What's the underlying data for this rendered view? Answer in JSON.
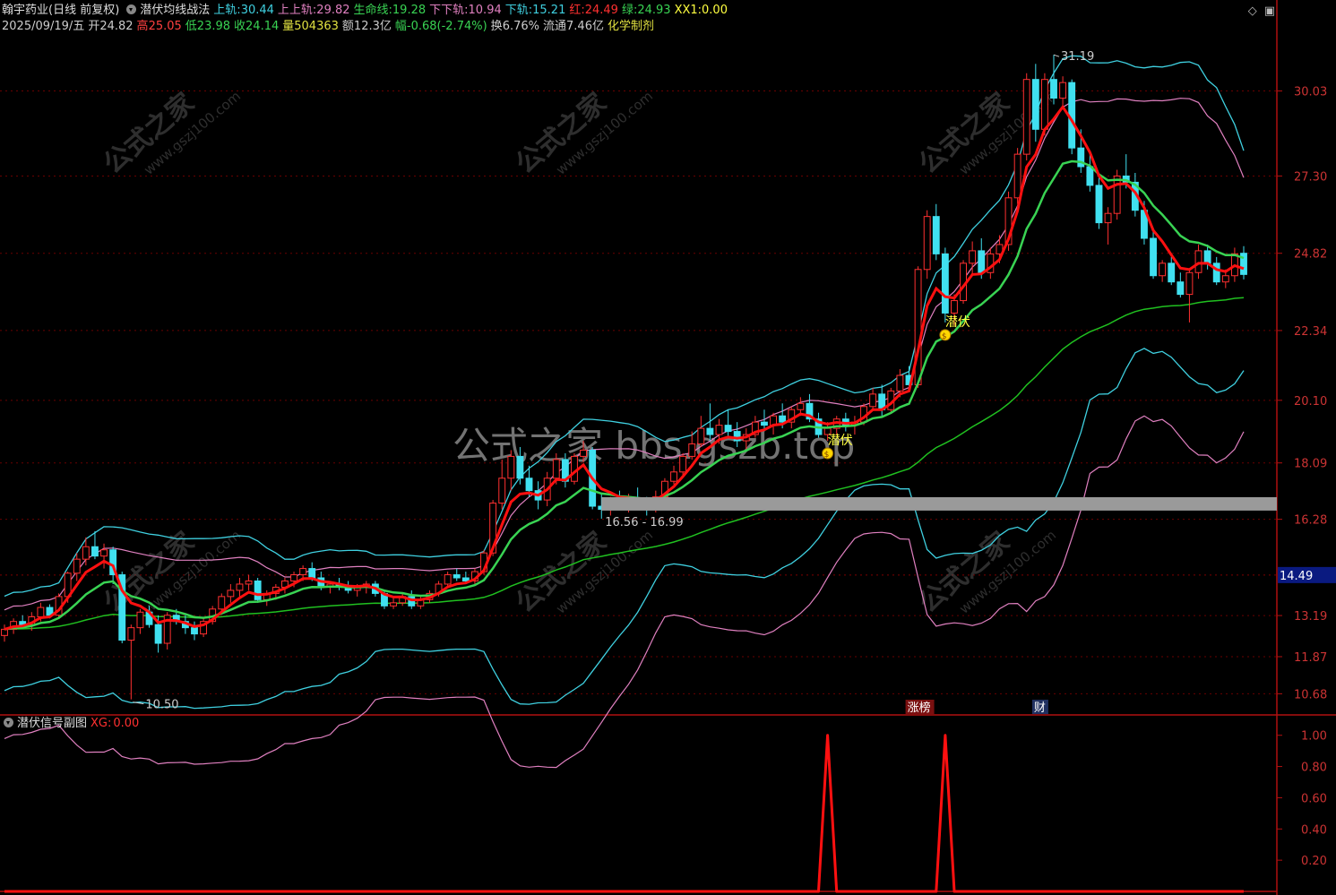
{
  "header": {
    "stock": "翰宇药业(日线 前复权)",
    "indicator": "潜伏均线战法",
    "values": [
      {
        "label": "上轨:",
        "value": "30.44",
        "color": "#3fd0e0"
      },
      {
        "label": "上上轨:",
        "value": "29.82",
        "color": "#e080c0"
      },
      {
        "label": "生命线:",
        "value": "19.28",
        "color": "#39d353"
      },
      {
        "label": "下下轨:",
        "value": "10.94",
        "color": "#e080c0"
      },
      {
        "label": "下轨:",
        "value": "15.21",
        "color": "#3fd0e0"
      },
      {
        "label": "红:",
        "value": "24.49",
        "color": "#ff3030"
      },
      {
        "label": "绿:",
        "value": "24.93",
        "color": "#39d353"
      },
      {
        "label": "XX1:",
        "value": "0.00",
        "color": "#ffff40"
      }
    ],
    "quote": [
      {
        "label": "2025/09/19/五",
        "value": "",
        "color": "#cccccc"
      },
      {
        "label": "开",
        "value": "24.82",
        "color": "#cccccc"
      },
      {
        "label": "高",
        "value": "25.05",
        "color": "#ff4040"
      },
      {
        "label": "低",
        "value": "23.98",
        "color": "#39d353"
      },
      {
        "label": "收",
        "value": "24.14",
        "color": "#39d353"
      },
      {
        "label": "量",
        "value": "504363",
        "color": "#e0e040"
      },
      {
        "label": "额",
        "value": "12.3亿",
        "color": "#cccccc"
      },
      {
        "label": "幅",
        "value": "-0.68(-2.74%)",
        "color": "#39d353"
      },
      {
        "label": "换",
        "value": "6.76%",
        "color": "#cccccc"
      },
      {
        "label": "流通",
        "value": "7.46亿",
        "color": "#cccccc"
      },
      {
        "label": "化学制剂",
        "value": "",
        "color": "#e0e040"
      }
    ],
    "corner_icons": [
      "diamond-icon",
      "maximize-icon"
    ]
  },
  "watermarks": {
    "center": "公式之家 bbs.gszb.top",
    "tile_cn": "公式之家",
    "tile_url": "www.gszj100.com"
  },
  "chart_data": [
    {
      "type": "candlestick",
      "yticks": [
        "30.03",
        "27.30",
        "24.82",
        "22.34",
        "20.10",
        "18.09",
        "16.28",
        "14.49",
        "13.19",
        "11.87",
        "10.68"
      ],
      "current_price": "14.49",
      "ylim": [
        10.0,
        31.8
      ],
      "colors": {
        "up": "#ff3030",
        "down": "#40e0f0",
        "ma_red": "#ff1010",
        "life_line": "#39d353",
        "upper_band": "#3fd0e0",
        "upper_upper_band": "#e080c0",
        "lower_band": "#3fd0e0",
        "lower_lower_band": "#e080c0",
        "long_ma": "#20c020"
      },
      "annotations": {
        "high": "31.19",
        "low": "10.50",
        "box_range": "16.56 - 16.99",
        "signal_label": "潜伏",
        "tags": [
          "涨榜",
          "财"
        ]
      },
      "ohlc": [
        [
          12.55,
          12.9,
          12.35,
          12.75
        ],
        [
          12.75,
          13.1,
          12.6,
          13.0
        ],
        [
          13.0,
          13.2,
          12.8,
          12.9
        ],
        [
          12.9,
          13.3,
          12.7,
          13.15
        ],
        [
          13.15,
          13.6,
          13.0,
          13.45
        ],
        [
          13.45,
          13.55,
          13.1,
          13.2
        ],
        [
          13.2,
          13.9,
          13.1,
          13.8
        ],
        [
          13.8,
          14.6,
          13.6,
          14.55
        ],
        [
          14.55,
          15.2,
          14.3,
          15.0
        ],
        [
          15.0,
          15.7,
          14.8,
          15.4
        ],
        [
          15.4,
          15.9,
          15.0,
          15.1
        ],
        [
          15.1,
          15.5,
          14.7,
          15.3
        ],
        [
          15.3,
          15.4,
          14.2,
          14.5
        ],
        [
          14.5,
          14.6,
          12.3,
          12.4
        ],
        [
          12.4,
          12.9,
          10.5,
          12.8
        ],
        [
          12.8,
          13.4,
          12.6,
          13.3
        ],
        [
          13.3,
          13.5,
          12.8,
          12.9
        ],
        [
          12.9,
          13.2,
          12.0,
          12.3
        ],
        [
          12.3,
          13.3,
          12.1,
          13.2
        ],
        [
          13.2,
          13.4,
          12.9,
          13.0
        ],
        [
          13.0,
          13.2,
          12.6,
          12.8
        ],
        [
          12.8,
          13.0,
          12.4,
          12.6
        ],
        [
          12.6,
          13.1,
          12.5,
          13.0
        ],
        [
          13.0,
          13.5,
          12.9,
          13.4
        ],
        [
          13.4,
          13.9,
          13.3,
          13.8
        ],
        [
          13.8,
          14.2,
          13.6,
          14.0
        ],
        [
          14.0,
          14.4,
          13.8,
          14.2
        ],
        [
          14.2,
          14.5,
          14.0,
          14.3
        ],
        [
          14.3,
          14.4,
          13.6,
          13.7
        ],
        [
          13.7,
          14.0,
          13.5,
          13.9
        ],
        [
          13.9,
          14.2,
          13.7,
          14.1
        ],
        [
          14.1,
          14.4,
          13.9,
          14.3
        ],
        [
          14.3,
          14.6,
          14.1,
          14.5
        ],
        [
          14.5,
          14.8,
          14.3,
          14.7
        ],
        [
          14.7,
          14.9,
          14.3,
          14.4
        ],
        [
          14.4,
          14.6,
          14.0,
          14.1
        ],
        [
          14.1,
          14.3,
          13.9,
          14.2
        ],
        [
          14.2,
          14.4,
          14.0,
          14.1
        ],
        [
          14.1,
          14.3,
          13.9,
          14.0
        ],
        [
          14.0,
          14.2,
          13.8,
          14.1
        ],
        [
          14.1,
          14.3,
          13.9,
          14.2
        ],
        [
          14.2,
          14.3,
          13.8,
          13.9
        ],
        [
          13.9,
          14.0,
          13.4,
          13.5
        ],
        [
          13.5,
          13.8,
          13.4,
          13.6
        ],
        [
          13.6,
          13.9,
          13.5,
          13.8
        ],
        [
          13.8,
          14.0,
          13.4,
          13.5
        ],
        [
          13.5,
          13.8,
          13.4,
          13.7
        ],
        [
          13.7,
          14.0,
          13.6,
          13.9
        ],
        [
          13.9,
          14.3,
          13.8,
          14.2
        ],
        [
          14.2,
          14.6,
          14.1,
          14.5
        ],
        [
          14.5,
          14.7,
          14.3,
          14.4
        ],
        [
          14.4,
          14.6,
          14.2,
          14.3
        ],
        [
          14.3,
          14.7,
          14.2,
          14.6
        ],
        [
          14.6,
          15.3,
          14.5,
          15.2
        ],
        [
          15.2,
          16.9,
          15.1,
          16.8
        ],
        [
          16.8,
          18.2,
          16.6,
          17.6
        ],
        [
          17.6,
          18.5,
          17.2,
          18.3
        ],
        [
          18.3,
          18.6,
          17.4,
          17.6
        ],
        [
          17.6,
          18.0,
          17.0,
          17.2
        ],
        [
          17.2,
          17.5,
          16.6,
          16.9
        ],
        [
          16.9,
          17.8,
          16.7,
          17.6
        ],
        [
          17.6,
          18.4,
          17.4,
          18.2
        ],
        [
          18.2,
          18.4,
          17.3,
          17.5
        ],
        [
          17.5,
          18.4,
          17.4,
          18.3
        ],
        [
          18.3,
          18.8,
          18.1,
          18.5
        ],
        [
          18.5,
          18.6,
          16.6,
          16.7
        ],
        [
          16.7,
          17.1,
          16.3,
          16.6
        ],
        [
          16.6,
          17.0,
          16.4,
          16.9
        ],
        [
          16.9,
          17.2,
          16.6,
          16.7
        ],
        [
          16.7,
          17.1,
          16.5,
          16.9
        ],
        [
          16.9,
          17.3,
          16.7,
          16.8
        ],
        [
          16.8,
          17.0,
          16.4,
          16.7
        ],
        [
          16.7,
          17.2,
          16.5,
          17.0
        ],
        [
          17.0,
          17.6,
          16.9,
          17.5
        ],
        [
          17.5,
          18.0,
          17.4,
          17.8
        ],
        [
          17.8,
          18.4,
          17.7,
          18.3
        ],
        [
          18.3,
          19.1,
          18.2,
          18.7
        ],
        [
          18.7,
          19.6,
          18.6,
          19.2
        ],
        [
          19.2,
          20.0,
          18.8,
          19.0
        ],
        [
          19.0,
          19.5,
          18.7,
          19.3
        ],
        [
          19.3,
          19.8,
          18.9,
          19.1
        ],
        [
          19.1,
          19.4,
          18.6,
          18.8
        ],
        [
          18.8,
          19.2,
          18.5,
          19.0
        ],
        [
          19.0,
          19.6,
          18.9,
          19.4
        ],
        [
          19.4,
          19.8,
          19.1,
          19.3
        ],
        [
          19.3,
          19.7,
          19.0,
          19.6
        ],
        [
          19.6,
          20.0,
          19.2,
          19.4
        ],
        [
          19.4,
          19.9,
          19.2,
          19.8
        ],
        [
          19.8,
          20.2,
          19.6,
          20.0
        ],
        [
          20.0,
          20.3,
          19.4,
          19.5
        ],
        [
          19.5,
          19.7,
          18.9,
          19.0
        ],
        [
          19.0,
          19.4,
          18.8,
          19.2
        ],
        [
          19.2,
          19.6,
          19.0,
          19.5
        ],
        [
          19.5,
          19.7,
          19.1,
          19.3
        ],
        [
          19.3,
          19.6,
          19.0,
          19.4
        ],
        [
          19.4,
          20.0,
          19.3,
          19.9
        ],
        [
          19.9,
          20.5,
          19.8,
          20.3
        ],
        [
          20.3,
          20.6,
          19.6,
          19.8
        ],
        [
          19.8,
          20.5,
          19.7,
          20.4
        ],
        [
          20.4,
          21.1,
          20.2,
          20.9
        ],
        [
          20.9,
          21.2,
          20.4,
          20.6
        ],
        [
          20.6,
          24.4,
          20.5,
          24.3
        ],
        [
          24.3,
          26.2,
          24.0,
          26.0
        ],
        [
          26.0,
          26.4,
          24.6,
          24.8
        ],
        [
          24.8,
          25.0,
          22.6,
          22.9
        ],
        [
          22.9,
          23.5,
          22.5,
          23.3
        ],
        [
          23.3,
          24.6,
          23.2,
          24.5
        ],
        [
          24.5,
          25.2,
          24.1,
          24.9
        ],
        [
          24.9,
          25.3,
          24.0,
          24.2
        ],
        [
          24.2,
          25.0,
          24.0,
          24.8
        ],
        [
          24.8,
          25.4,
          24.5,
          25.1
        ],
        [
          25.1,
          26.8,
          24.9,
          26.6
        ],
        [
          26.6,
          28.2,
          26.4,
          28.0
        ],
        [
          28.0,
          30.6,
          27.8,
          30.4
        ],
        [
          30.4,
          30.9,
          28.4,
          28.8
        ],
        [
          28.8,
          30.6,
          28.6,
          30.4
        ],
        [
          30.4,
          31.19,
          29.6,
          29.8
        ],
        [
          29.8,
          30.5,
          29.5,
          30.3
        ],
        [
          30.3,
          30.4,
          28.0,
          28.2
        ],
        [
          28.2,
          28.8,
          27.4,
          27.6
        ],
        [
          27.6,
          28.1,
          26.8,
          27.0
        ],
        [
          27.0,
          27.3,
          25.6,
          25.8
        ],
        [
          25.8,
          26.3,
          25.1,
          26.1
        ],
        [
          26.1,
          27.5,
          25.9,
          27.3
        ],
        [
          27.3,
          28.0,
          26.9,
          27.1
        ],
        [
          27.1,
          27.4,
          26.0,
          26.2
        ],
        [
          26.2,
          26.5,
          25.1,
          25.3
        ],
        [
          25.3,
          25.5,
          24.0,
          24.1
        ],
        [
          24.1,
          24.6,
          23.9,
          24.5
        ],
        [
          24.5,
          24.7,
          23.8,
          23.9
        ],
        [
          23.9,
          24.2,
          23.4,
          23.5
        ],
        [
          23.5,
          24.3,
          22.6,
          24.2
        ],
        [
          24.2,
          25.1,
          24.0,
          24.9
        ],
        [
          24.9,
          25.1,
          24.3,
          24.5
        ],
        [
          24.5,
          24.7,
          23.8,
          23.9
        ],
        [
          23.9,
          24.3,
          23.7,
          24.1
        ],
        [
          24.1,
          25.0,
          23.9,
          24.8
        ],
        [
          24.82,
          25.05,
          23.98,
          24.14
        ]
      ]
    },
    {
      "type": "line",
      "title": "潜伏信号副图",
      "series_label": "XG:",
      "series_value": "0.00",
      "yticks": [
        "1.00",
        "0.80",
        "0.60",
        "0.40",
        "0.20"
      ],
      "ylim": [
        0,
        1.05
      ],
      "signal_indices": [
        91,
        104
      ]
    }
  ]
}
